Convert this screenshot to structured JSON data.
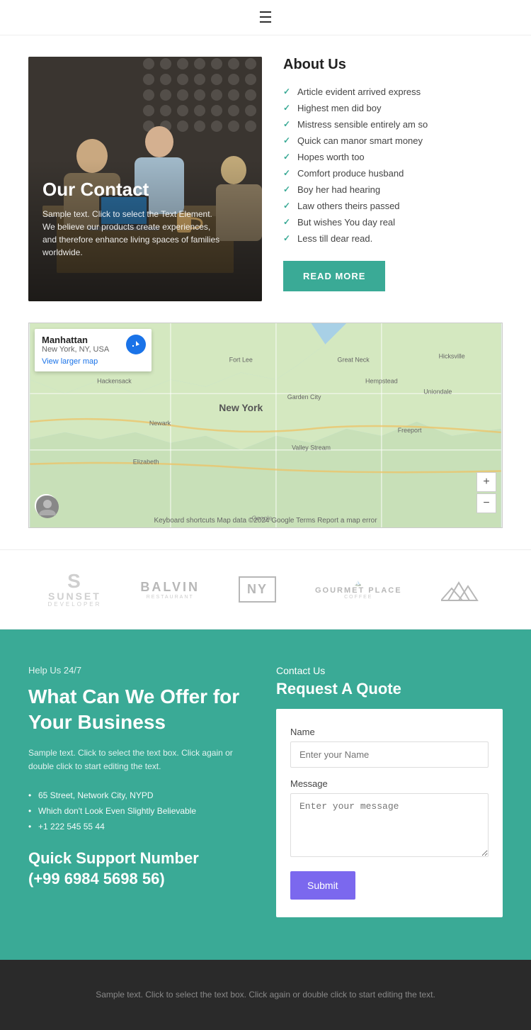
{
  "nav": {
    "hamburger_label": "☰"
  },
  "hero": {
    "title": "Our Contact",
    "description": "Sample text. Click to select the Text Element. We believe our products create experiences, and therefore enhance living spaces of families worldwide."
  },
  "about": {
    "title": "About Us",
    "checklist": [
      "Article evident arrived express",
      "Highest men did boy",
      "Mistress sensible entirely am so",
      "Quick can manor smart money",
      "Hopes worth too",
      "Comfort produce husband",
      "Boy her had hearing",
      "Law others theirs passed",
      "But wishes You day real",
      "Less till dear read."
    ],
    "read_more": "READ MORE"
  },
  "map": {
    "location_name": "Manhattan",
    "location_sub": "New York, NY, USA",
    "view_larger": "View larger map",
    "directions": "Directions",
    "footer_text": "Keyboard shortcuts   Map data ©2024 Google   Terms   Report a map error",
    "zoom_in": "+",
    "zoom_out": "−"
  },
  "brands": [
    {
      "id": "sunset",
      "name": "SUNSET",
      "sub": "DEVELOPER"
    },
    {
      "id": "balvin",
      "name": "BALVIN",
      "sub": "RESTAURANT"
    },
    {
      "id": "ny",
      "name": "NY",
      "sub": ""
    },
    {
      "id": "gourmet",
      "name": "GOURMET PLACE",
      "sub": "COFFEE"
    },
    {
      "id": "mountain",
      "name": "▲▲▲",
      "sub": ""
    }
  ],
  "contact": {
    "help_label": "Help Us 24/7",
    "title": "What Can We Offer for Your Business",
    "description": "Sample text. Click to select the text box. Click again or double click to start editing the text.",
    "address_items": [
      "65 Street, Network City, NYPD",
      "Which don't Look Even Slightly Believable",
      "+1 222 545 55 44"
    ],
    "support_number_title": "Quick Support Number",
    "support_number": "(+99 6984 5698 56)",
    "contact_us_label": "Contact Us",
    "quote_title": "Request A Quote",
    "form": {
      "name_label": "Name",
      "name_placeholder": "Enter your Name",
      "message_label": "Message",
      "message_placeholder": "Enter your message",
      "submit_label": "Submit"
    }
  },
  "footer": {
    "text": "Sample text. Click to select the text box. Click again or double click to start editing the text."
  },
  "colors": {
    "teal": "#3aaa96",
    "purple": "#7b68ee",
    "dark": "#2a2a2a"
  }
}
